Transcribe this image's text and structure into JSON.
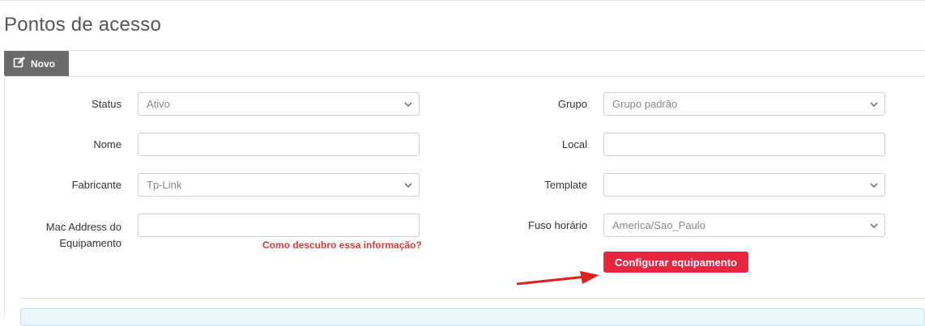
{
  "page": {
    "title": "Pontos de acesso"
  },
  "tabs": {
    "novo": "Novo"
  },
  "form": {
    "status": {
      "label": "Status",
      "value": "Ativo"
    },
    "nome": {
      "label": "Nome",
      "value": ""
    },
    "fabricante": {
      "label": "Fabricante",
      "value": "Tp-Link"
    },
    "mac": {
      "label_line1": "Mac Address do",
      "label_line2": "Equipamento",
      "value": ""
    },
    "grupo": {
      "label": "Grupo",
      "value": "Grupo padrão"
    },
    "local": {
      "label": "Local",
      "value": ""
    },
    "template": {
      "label": "Template",
      "value": ""
    },
    "fuso": {
      "label": "Fuso horário",
      "value": "America/Sao_Paulo"
    },
    "help_link": "Como descubro essa informação?",
    "config_button": "Configurar equipamento"
  },
  "colors": {
    "accent": "#e8263f",
    "link": "#d43b3b",
    "tab": "#6b6b6b",
    "arrow": "#e02020"
  }
}
